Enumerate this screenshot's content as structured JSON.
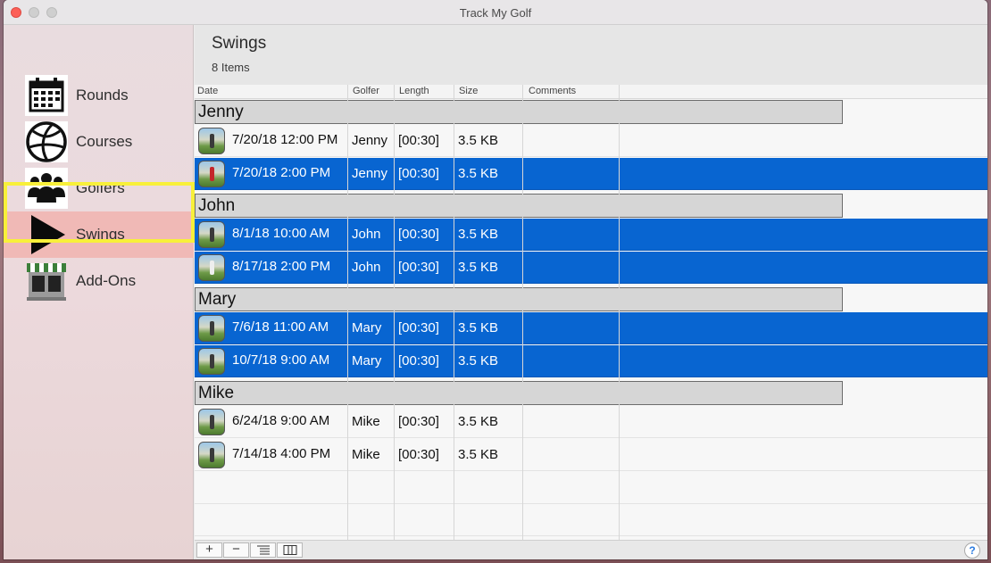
{
  "window": {
    "title": "Track My Golf"
  },
  "sidebar": {
    "items": [
      {
        "label": "Rounds",
        "icon": "calendar-icon"
      },
      {
        "label": "Courses",
        "icon": "globe-icon"
      },
      {
        "label": "Golfers",
        "icon": "people-icon"
      },
      {
        "label": "Swings",
        "icon": "play-icon",
        "selected": true
      },
      {
        "label": "Add-Ons",
        "icon": "store-icon"
      }
    ]
  },
  "main": {
    "title": "Swings",
    "count": "8 Items",
    "columns": [
      "Date",
      "Golfer",
      "Length",
      "Size",
      "Comments"
    ],
    "groups": [
      {
        "name": "Jenny",
        "rows": [
          {
            "date": "7/20/18 12:00 PM",
            "golfer": "Jenny",
            "length": "[00:30]",
            "size": "3.5 KB",
            "selected": false
          },
          {
            "date": "7/20/18 2:00 PM",
            "golfer": "Jenny",
            "length": "[00:30]",
            "size": "3.5 KB",
            "selected": true
          }
        ]
      },
      {
        "name": "John",
        "rows": [
          {
            "date": "8/1/18 10:00 AM",
            "golfer": "John",
            "length": "[00:30]",
            "size": "3.5 KB",
            "selected": true
          },
          {
            "date": "8/17/18 2:00 PM",
            "golfer": "John",
            "length": "[00:30]",
            "size": "3.5 KB",
            "selected": true
          }
        ]
      },
      {
        "name": "Mary",
        "rows": [
          {
            "date": "7/6/18 11:00 AM",
            "golfer": "Mary",
            "length": "[00:30]",
            "size": "3.5 KB",
            "selected": true
          },
          {
            "date": "10/7/18 9:00 AM",
            "golfer": "Mary",
            "length": "[00:30]",
            "size": "3.5 KB",
            "selected": true
          }
        ]
      },
      {
        "name": "Mike",
        "rows": [
          {
            "date": "6/24/18 9:00 AM",
            "golfer": "Mike",
            "length": "[00:30]",
            "size": "3.5 KB",
            "selected": false
          },
          {
            "date": "7/14/18 4:00 PM",
            "golfer": "Mike",
            "length": "[00:30]",
            "size": "3.5 KB",
            "selected": false
          }
        ]
      }
    ]
  },
  "bottom_bar": {
    "add_label": "+",
    "remove_label": "−",
    "help_label": "?"
  },
  "colors": {
    "selection": "#0865d1",
    "sidebar_selected": "#f0b9b6",
    "highlight": "#f8f03a"
  }
}
